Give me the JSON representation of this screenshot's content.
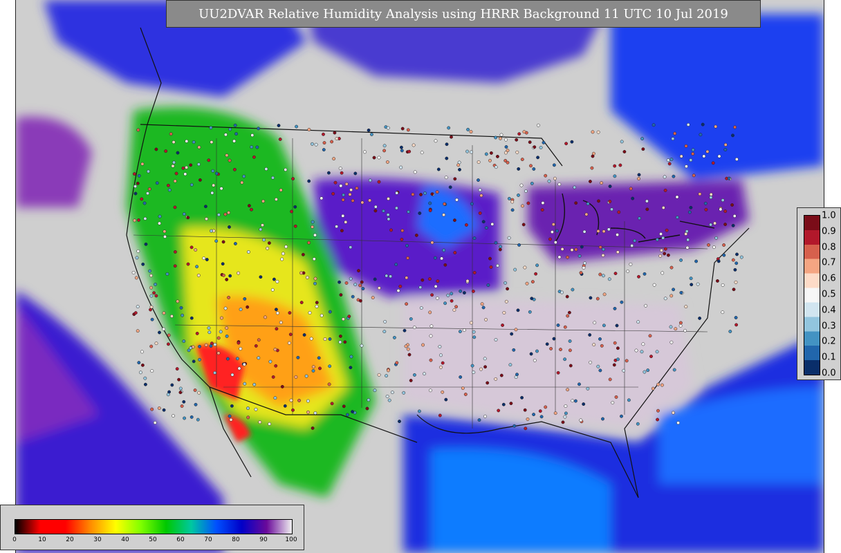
{
  "title": "UU2DVAR Relative Humidity Analysis using HRRR Background 11 UTC 10 Jul 2019",
  "colors": {
    "background_gray": "#cfcfcf",
    "title_box": "#8a8a8a",
    "boundary": "#111111"
  },
  "rh_legend": {
    "ticks": [
      "0",
      "10",
      "20",
      "30",
      "40",
      "50",
      "60",
      "70",
      "80",
      "90",
      "100"
    ],
    "stops": [
      "#000000",
      "#ff0000",
      "#ff0000",
      "#ff8c00",
      "#ffff00",
      "#7fff00",
      "#00c800",
      "#00c8a0",
      "#0050ff",
      "#0000c8",
      "#6a0a9a",
      "#f0f0f0"
    ]
  },
  "innovation_legend": {
    "ticks": [
      "1.0",
      "0.9",
      "0.8",
      "0.7",
      "0.6",
      "0.5",
      "0.4",
      "0.3",
      "0.2",
      "0.1",
      "0.0"
    ],
    "stops": [
      "#7a0c18",
      "#b2182b",
      "#d6604d",
      "#f4a582",
      "#fddbc7",
      "#f7f7f7",
      "#d1e5f0",
      "#92c5de",
      "#4393c3",
      "#2166ac",
      "#0a2e6a"
    ]
  }
}
